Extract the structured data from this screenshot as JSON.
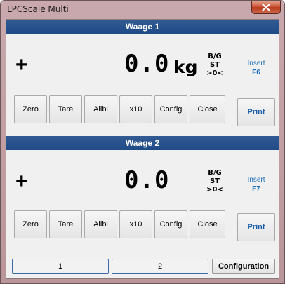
{
  "window": {
    "title": "LPCScale Multi",
    "close_icon": "close-x-icon"
  },
  "scales": [
    {
      "header": "Waage 1",
      "sign": "+",
      "value": "0.0",
      "unit": "kg",
      "status": [
        "B/G",
        "ST",
        ">0<"
      ],
      "insert_label": "Insert",
      "insert_key": "F6",
      "buttons": [
        "Zero",
        "Tare",
        "Alibi",
        "x10",
        "Config",
        "Close"
      ],
      "print_label": "Print"
    },
    {
      "header": "Waage 2",
      "sign": "+",
      "value": "0.0",
      "unit": "",
      "status": [
        "B/G",
        "ST",
        ">0<"
      ],
      "insert_label": "Insert",
      "insert_key": "F7",
      "buttons": [
        "Zero",
        "Tare",
        "Alibi",
        "x10",
        "Config",
        "Close"
      ],
      "print_label": "Print"
    }
  ],
  "footer": {
    "tabs": [
      "1",
      "2"
    ],
    "configuration_label": "Configuration"
  },
  "colors": {
    "header_bg": "#1e4a86",
    "accent_text": "#1c6fb8",
    "titlebar": "#c9a9ad",
    "close_button": "#cc5a3e"
  }
}
